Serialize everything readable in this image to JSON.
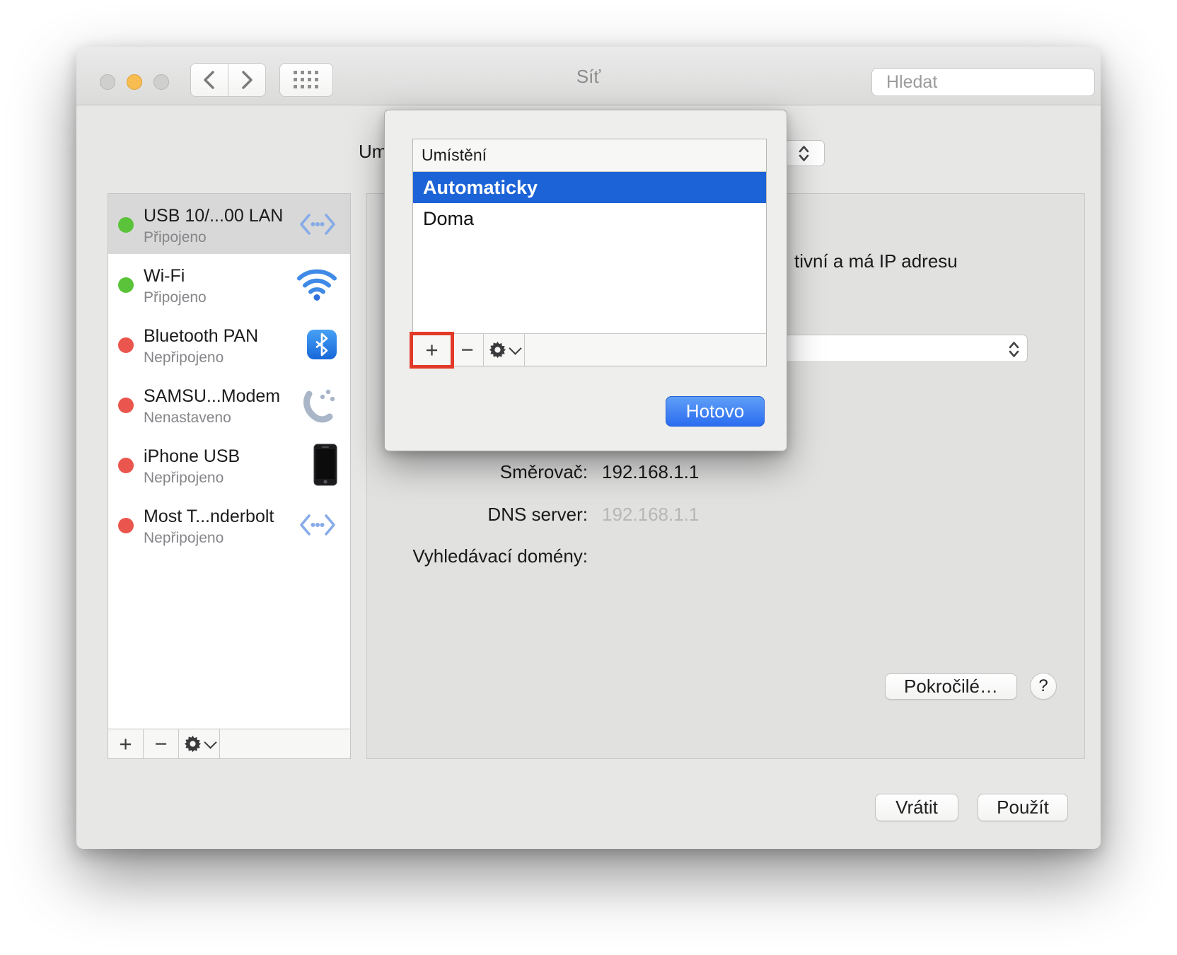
{
  "window": {
    "title": "Síť",
    "search_placeholder": "Hledat",
    "traffic_lights": [
      "close",
      "minimize",
      "zoom"
    ]
  },
  "main": {
    "location_label_fragment": "Um",
    "status_text_fragment": "tivní a má IP adresu",
    "rows": [
      {
        "label": "Směrovač:",
        "value": "192.168.1.1",
        "muted": false
      },
      {
        "label": "DNS server:",
        "value": "192.168.1.1",
        "muted": true
      },
      {
        "label": "Vyhledávací domény:",
        "value": "",
        "muted": false
      }
    ],
    "advanced_label": "Pokročilé…",
    "help_label": "?"
  },
  "sidebar": {
    "services": [
      {
        "name": "USB 10/...00 LAN",
        "status": "Připojeno",
        "state": "connected",
        "icon": "ethernet-icon",
        "selected": true
      },
      {
        "name": "Wi-Fi",
        "status": "Připojeno",
        "state": "connected",
        "icon": "wifi-icon",
        "selected": false
      },
      {
        "name": "Bluetooth PAN",
        "status": "Nepřipojeno",
        "state": "disconnected",
        "icon": "bluetooth-icon",
        "selected": false
      },
      {
        "name": "SAMSU...Modem",
        "status": "Nenastaveno",
        "state": "disconnected",
        "icon": "modem-icon",
        "selected": false
      },
      {
        "name": "iPhone USB",
        "status": "Nepřipojeno",
        "state": "disconnected",
        "icon": "iphone-icon",
        "selected": false
      },
      {
        "name": "Most T...nderbolt",
        "status": "Nepřipojeno",
        "state": "disconnected",
        "icon": "thunderbolt-bridge-icon",
        "selected": false
      }
    ],
    "tools": [
      "add",
      "remove",
      "actions"
    ]
  },
  "location_popover": {
    "header": "Umístění",
    "items": [
      {
        "label": "Automaticky",
        "selected": true
      },
      {
        "label": "Doma",
        "selected": false
      }
    ],
    "tools": [
      "add",
      "remove",
      "actions"
    ],
    "done_label": "Hotovo",
    "annotation": "red-highlight-on-add-button"
  },
  "footer": {
    "revert_label": "Vrátit",
    "apply_label": "Použít"
  },
  "colors": {
    "selection_blue": "#1c63d8",
    "done_button_blue_top": "#5f9ff7",
    "done_button_blue_bottom": "#2a6cf0",
    "connected_green": "#5ac339",
    "disconnected_red": "#ea564d",
    "annotation_red": "#e23a28",
    "service_icon_blue": "#86abe8",
    "wifi_blue": "#3f8ae6"
  }
}
